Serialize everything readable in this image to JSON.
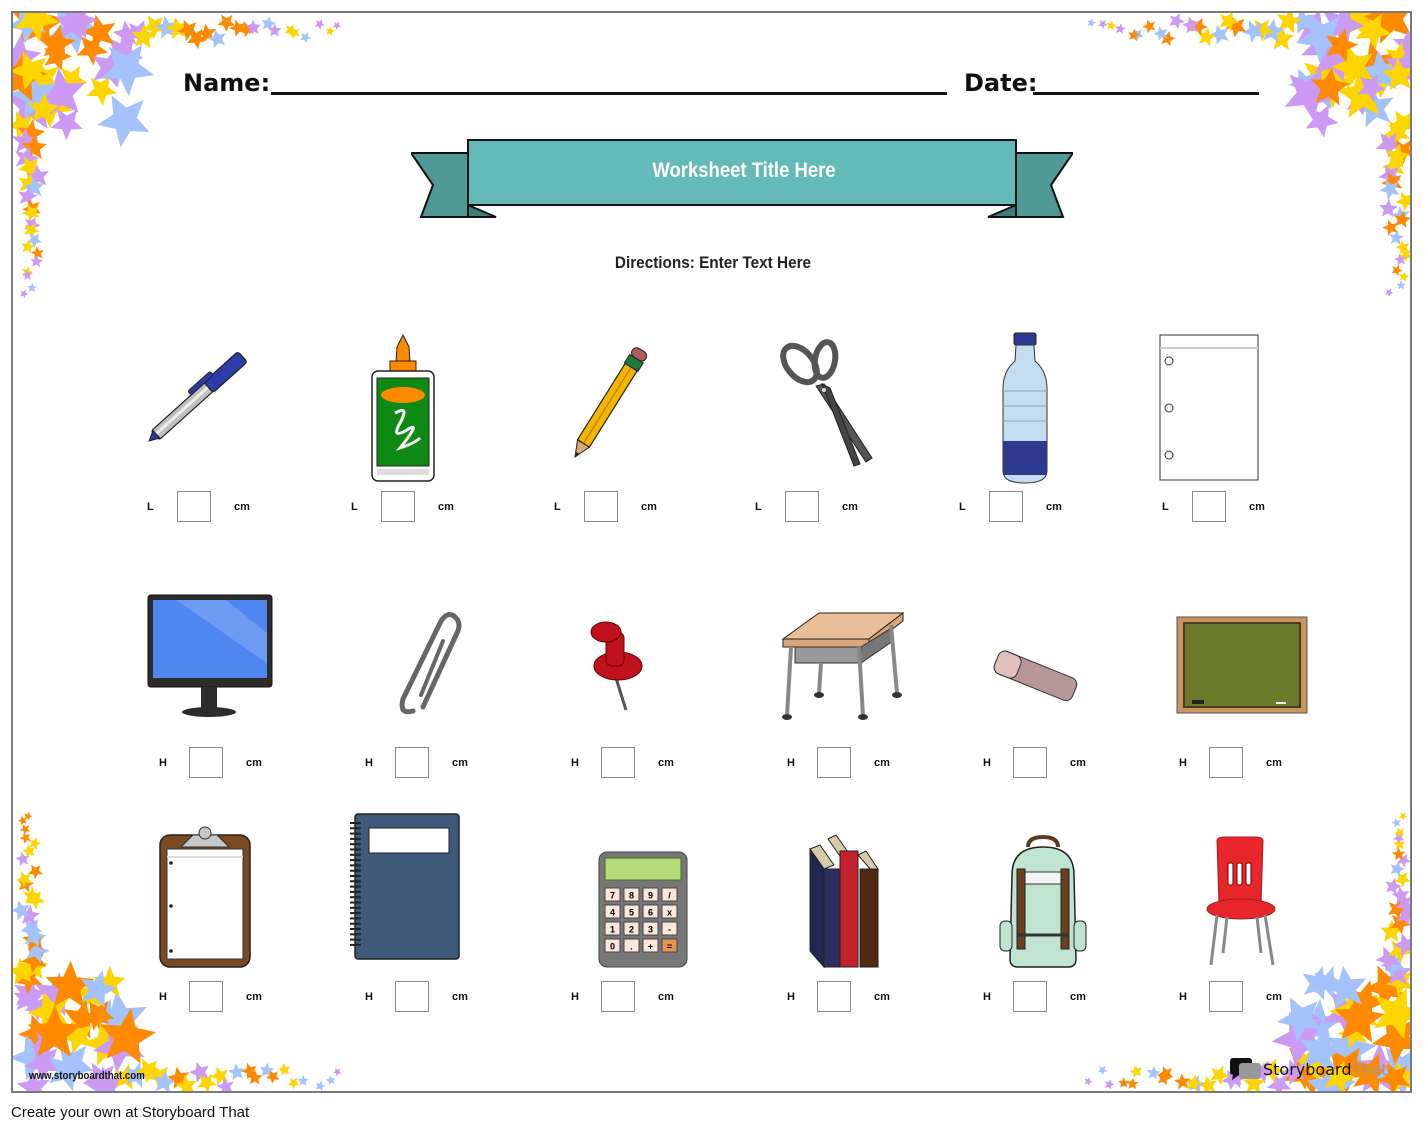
{
  "header": {
    "name_label": "Name:",
    "date_label": "Date:"
  },
  "banner": {
    "title": "Worksheet Title Here",
    "color_front": "#64bab8",
    "color_back": "#4f9a96"
  },
  "directions": "Directions: Enter Text Here",
  "measure_unit": "cm",
  "rows": [
    {
      "measure_label": "L",
      "items": [
        {
          "name": "pen"
        },
        {
          "name": "glue bottle"
        },
        {
          "name": "pencil"
        },
        {
          "name": "scissors"
        },
        {
          "name": "water bottle"
        },
        {
          "name": "sheet of paper"
        }
      ]
    },
    {
      "measure_label": "H",
      "items": [
        {
          "name": "computer monitor"
        },
        {
          "name": "paper clip"
        },
        {
          "name": "push pin"
        },
        {
          "name": "school desk"
        },
        {
          "name": "eraser"
        },
        {
          "name": "chalkboard"
        }
      ]
    },
    {
      "measure_label": "H",
      "items": [
        {
          "name": "clipboard"
        },
        {
          "name": "notebook"
        },
        {
          "name": "calculator"
        },
        {
          "name": "books"
        },
        {
          "name": "backpack"
        },
        {
          "name": "chair"
        }
      ]
    }
  ],
  "calculator_keys": [
    "7",
    "8",
    "9",
    "/",
    "4",
    "5",
    "6",
    "x",
    "1",
    "2",
    "3",
    "-",
    "0",
    ".",
    "+",
    "="
  ],
  "branding": {
    "site": "www.storyboardthat.com",
    "logo_word1": "Storyboard",
    "logo_word2": "That"
  },
  "footer": "Create your own at Storyboard That",
  "star_colors": [
    "#ffd500",
    "#cc99f5",
    "#a4c2fb",
    "#ff8a00"
  ]
}
